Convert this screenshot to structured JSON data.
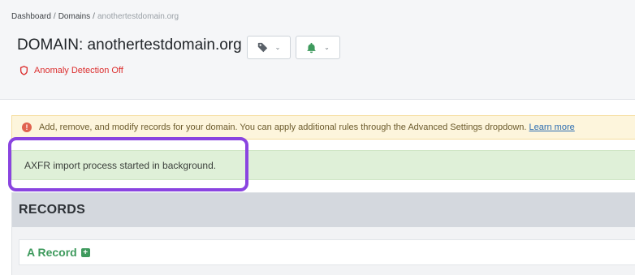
{
  "breadcrumb": {
    "items": [
      "Dashboard",
      "Domains",
      "anothertestdomain.org"
    ],
    "separator": "/"
  },
  "page": {
    "title": "DOMAIN: anothertestdomain.org",
    "tag_button_icon": "tag-icon",
    "bell_button_icon": "bell-icon"
  },
  "anomaly": {
    "label": "Anomaly Detection Off",
    "icon": "shield-icon",
    "color": "#dc2f2f"
  },
  "info_alert": {
    "icon": "exclamation-circle-icon",
    "text": "Add, remove, and modify records for your domain. You can apply additional rules through the Advanced Settings dropdown.",
    "link": "Learn more"
  },
  "success_alert": {
    "text": "AXFR import process started in background."
  },
  "records": {
    "heading": "RECORDS",
    "sections": [
      {
        "title": "A Record",
        "add_icon": "plus-square-icon"
      }
    ]
  },
  "colors": {
    "highlight": "#8a44e0",
    "success_bg": "#dff0d8",
    "info_bg": "#fdf5dc",
    "record_green": "#3e9a5d"
  }
}
